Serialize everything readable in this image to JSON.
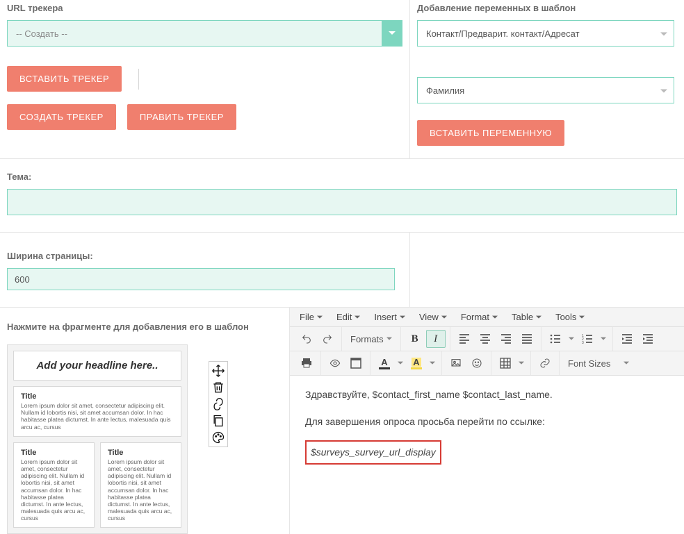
{
  "tracker": {
    "label": "URL трекера",
    "select_value": "-- Создать --",
    "insert_btn": "ВСТАВИТЬ ТРЕКЕР",
    "create_btn": "СОЗДАТЬ ТРЕКЕР",
    "edit_btn": "ПРАВИТЬ ТРЕКЕР"
  },
  "variables": {
    "label": "Добавление переменных в шаблон",
    "group_value": "Контакт/Предварит. контакт/Адресат",
    "field_value": "Фамилия",
    "insert_btn": "ВСТАВИТЬ ПЕРЕМЕННУЮ"
  },
  "topic": {
    "label": "Тема:",
    "value": ""
  },
  "page_width": {
    "label": "Ширина страницы:",
    "value": "600"
  },
  "fragments": {
    "title": "Нажмите на фрагменте для добавления его в шаблон",
    "headline": "Add your headline here..",
    "sample_title": "Title",
    "lorem": "Lorem ipsum dolor sit amet, consectetur adipiscing elit. Nullam id lobortis nisi, sit amet accumsan dolor. In hac habitasse platea dictumst. In ante lectus, malesuada quis arcu ac, cursus"
  },
  "editor": {
    "menus": {
      "file": "File",
      "edit": "Edit",
      "insert": "Insert",
      "view": "View",
      "format": "Format",
      "table": "Table",
      "tools": "Tools"
    },
    "formats_label": "Formats",
    "font_sizes_label": "Font Sizes",
    "body": {
      "greeting": "Здравствуйте, $contact_first_name $contact_last_name.",
      "instruction": "Для завершения опроса просьба перейти по ссылке:",
      "placeholder": "$surveys_survey_url_display"
    }
  }
}
